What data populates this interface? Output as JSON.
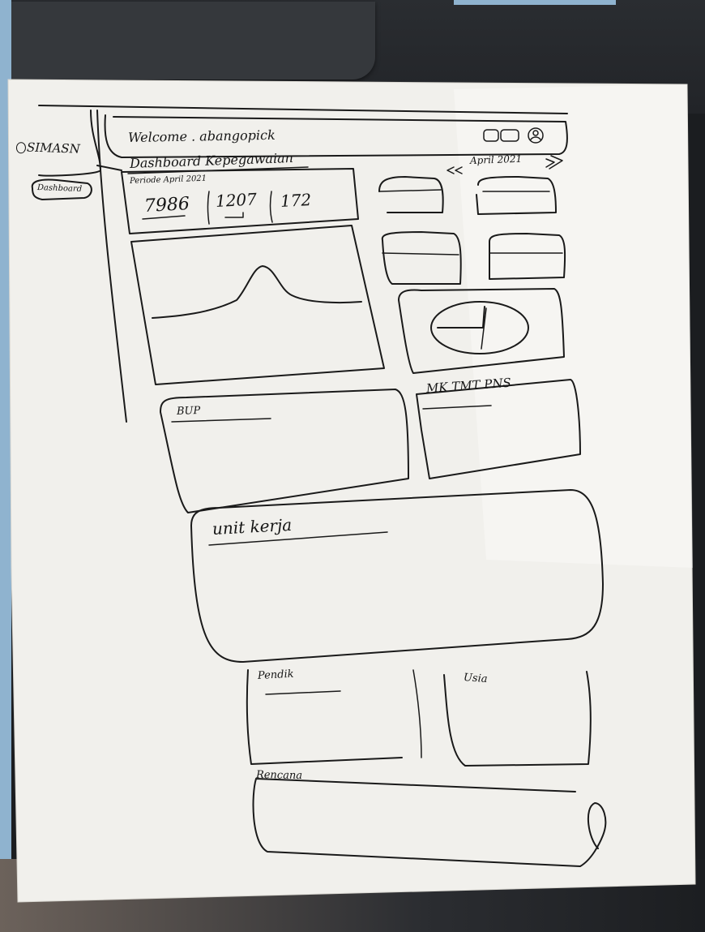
{
  "sidebar": {
    "logo": "SIMASN",
    "menu_item": "Dashboard"
  },
  "header": {
    "welcome": "Welcome . abangopick"
  },
  "dashboard": {
    "title": "Dashboard Kepegawaian",
    "period_nav": "April 2021",
    "summary": {
      "period": "Periode April 2021",
      "values": [
        "7986",
        "1207",
        "172"
      ]
    }
  },
  "cards": {
    "bup": "BUP",
    "mk_tmt": "MK TMT PNS",
    "unit_kerja": "unit kerja",
    "pendidikan": "Pendik",
    "usia": "Usia",
    "rencana": "Rencana"
  },
  "icons": [
    "notification-icon",
    "mail-icon",
    "user-avatar-icon",
    "chevron-left-icon",
    "chevron-right-icon"
  ]
}
